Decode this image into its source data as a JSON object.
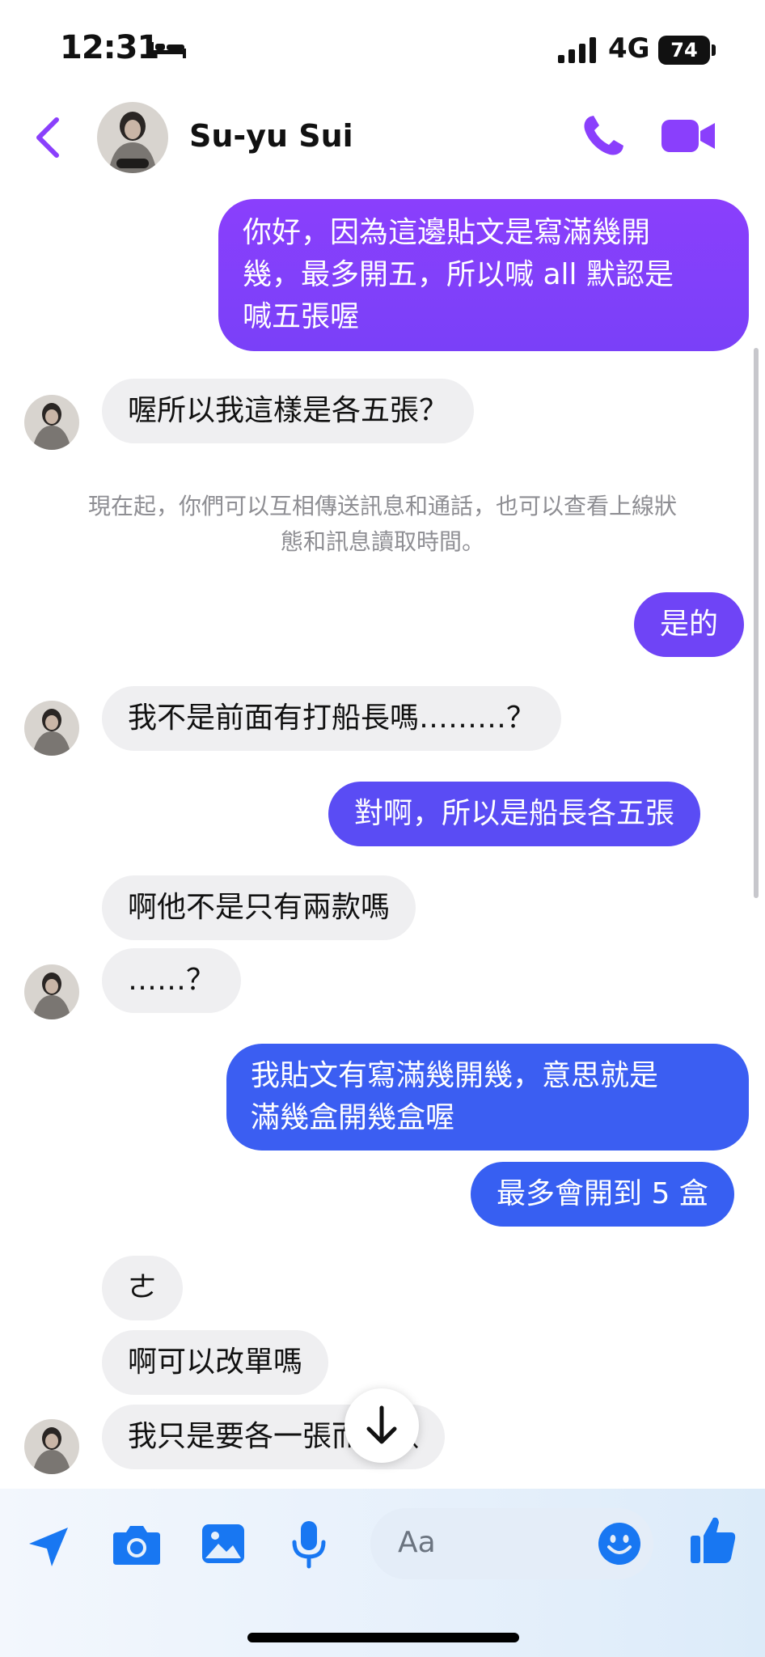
{
  "status": {
    "time": "12:31",
    "network": "4G",
    "battery": "74"
  },
  "header": {
    "contact_name": "Su-yu Sui"
  },
  "messages": [
    {
      "dir": "out",
      "lines": [
        "你好，因為這邊貼文是寫滿幾開",
        "幾，最多開五，所以喊 all 默認是",
        "喊五張喔"
      ]
    },
    {
      "dir": "in",
      "lines": [
        "喔所以我這樣是各五張？"
      ]
    },
    {
      "dir": "out",
      "lines": [
        "是的"
      ]
    },
    {
      "dir": "in",
      "lines": [
        "我不是前面有打船長嗎………？"
      ]
    },
    {
      "dir": "out",
      "lines": [
        "對啊，所以是船長各五張"
      ]
    },
    {
      "dir": "in",
      "lines": [
        "啊他不是只有兩款嗎"
      ]
    },
    {
      "dir": "in",
      "lines": [
        "……？"
      ]
    },
    {
      "dir": "out",
      "lines": [
        "我貼文有寫滿幾開幾，意思就是",
        "滿幾盒開幾盒喔"
      ]
    },
    {
      "dir": "out",
      "lines": [
        "最多會開到 5 盒"
      ]
    },
    {
      "dir": "in",
      "lines": [
        "ㄜ"
      ]
    },
    {
      "dir": "in",
      "lines": [
        "啊可以改單嗎"
      ]
    },
    {
      "dir": "in",
      "lines": [
        "我只是要各一張而已欸"
      ]
    }
  ],
  "system_note": {
    "lines": [
      "現在起，你們可以互相傳送訊息和通話，也可以查看上線狀",
      "態和訊息讀取時間。"
    ]
  },
  "composer": {
    "placeholder": "Aa"
  },
  "colors": {
    "accent": "#8a3ffc",
    "out_purple": "#8a3ffc",
    "out_violet": "#6a45f5",
    "out_blue": "#3a5df2",
    "icon_blue": "#1877f2"
  },
  "icons": [
    "back-icon",
    "phone-icon",
    "video-icon",
    "location-icon",
    "camera-icon",
    "gallery-icon",
    "microphone-icon",
    "emoji-icon",
    "thumbs-up-icon",
    "arrow-down-icon"
  ]
}
